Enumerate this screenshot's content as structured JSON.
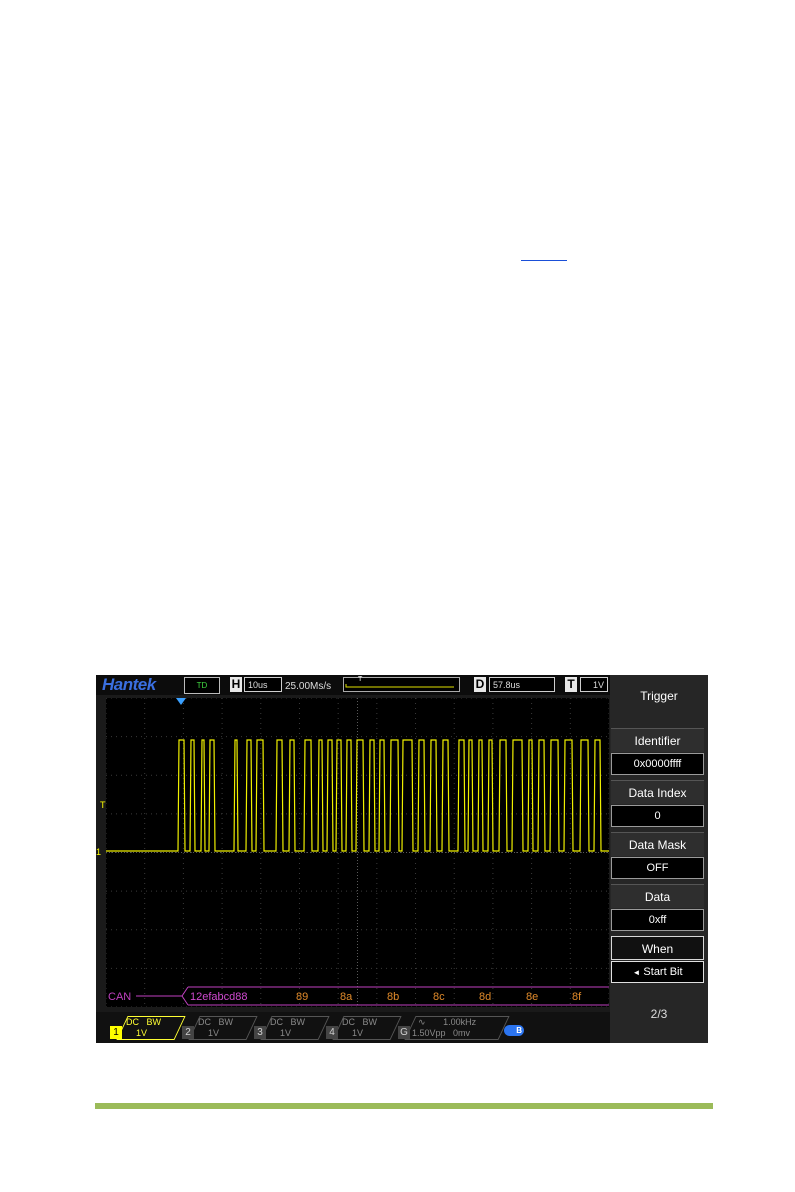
{
  "topbar": {
    "logo": "Hantek",
    "run_status": "TD",
    "horizontal_tag": "H",
    "timebase": "10us",
    "sample_rate": "25.00Ms/s",
    "trigger_pos_marker": "T",
    "delay_tag": "D",
    "delay_value": "57.8us",
    "trigger_tag": "T",
    "trigger_level": "1V"
  },
  "waveform": {
    "trigger_level_marker": "T",
    "channel_marker": "1",
    "bus_label": "CAN",
    "decode_values": [
      "12efabcd88",
      "89",
      "8a",
      "8b",
      "8c",
      "8d",
      "8e",
      "8f"
    ],
    "trace_color": "#f0f000",
    "bus_color": "#c040c0"
  },
  "menu": {
    "title": "Trigger",
    "items": [
      {
        "label": "Identifier",
        "value": "0x0000ffff"
      },
      {
        "label": "Data Index",
        "value": "0"
      },
      {
        "label": "Data Mask",
        "value": "OFF"
      },
      {
        "label": "Data",
        "value": "0xff"
      },
      {
        "label": "When",
        "value": "Start Bit"
      }
    ],
    "page": "2/3"
  },
  "channels": [
    {
      "num": "1",
      "coupling": "DC",
      "bw": "BW",
      "scale": "1V"
    },
    {
      "num": "2",
      "coupling": "DC",
      "bw": "BW",
      "scale": "1V"
    },
    {
      "num": "3",
      "coupling": "DC",
      "bw": "BW",
      "scale": "1V"
    },
    {
      "num": "4",
      "coupling": "DC",
      "bw": "BW",
      "scale": "1V"
    }
  ],
  "generator": {
    "num": "G",
    "freq": "1.00kHz",
    "amplitude": "1.50Vpp",
    "offset": "0mv"
  },
  "status_icon": "B"
}
